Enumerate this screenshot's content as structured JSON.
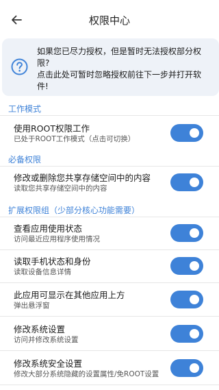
{
  "header": {
    "title": "权限中心",
    "back_icon": "arrow-left-icon"
  },
  "notice": {
    "icon": "question-circle-icon",
    "line1": "如果您已尽力授权，但是暂时无法授权部分权",
    "line2": "限?",
    "line3": "点击此处可暂时忽略授权前往下一步并打开软",
    "line4": "件!"
  },
  "sections": {
    "work_mode": "工作模式",
    "required": "必备权限",
    "extended": "扩展权限组（少部分核心功能需要）"
  },
  "rows": [
    {
      "title": "使用ROOT权限工作",
      "subtitle": "已处于ROOT工作模式（点击可切换）",
      "enabled": true
    },
    {
      "title": "修改或删除您共享存储空间中的内容",
      "subtitle": "读取您共享存储空间中的内容",
      "enabled": true
    },
    {
      "title": "查看应用使用状态",
      "subtitle": "访问最近应用程序使用情况",
      "enabled": true
    },
    {
      "title": "读取手机状态和身份",
      "subtitle": "读取设备信息详情",
      "enabled": true
    },
    {
      "title": "此应用可显示在其他应用上方",
      "subtitle": "弹出悬浮窗",
      "enabled": true
    },
    {
      "title": "修改系统设置",
      "subtitle": "访问并修改系统设置",
      "enabled": true
    },
    {
      "title": "修改系统安全设置",
      "subtitle": "修改大部分系统隐藏的设置属性/免ROOT设置",
      "enabled": true
    }
  ],
  "colors": {
    "accent": "#3e82d8",
    "notice_bg": "#eef2f8",
    "divider": "#e6e6e6"
  }
}
